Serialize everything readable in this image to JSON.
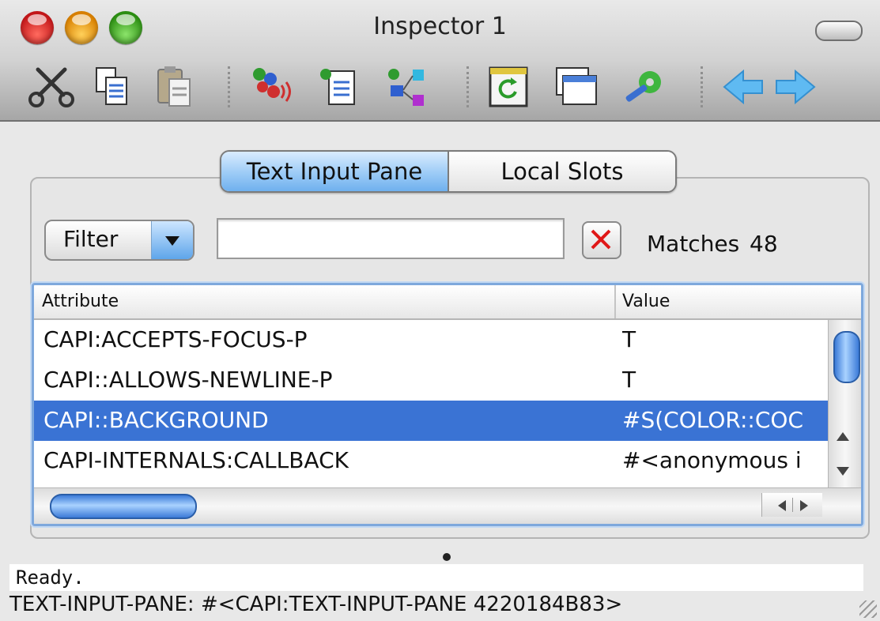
{
  "window": {
    "title": "Inspector 1"
  },
  "toolbar": {
    "buttons": [
      {
        "name": "cut",
        "icon": "scissors-icon"
      },
      {
        "name": "copy",
        "icon": "copy-icon"
      },
      {
        "name": "paste",
        "icon": "paste-icon"
      },
      {
        "name": "inspect-object",
        "icon": "object-signal-icon"
      },
      {
        "name": "browse",
        "icon": "document-list-icon"
      },
      {
        "name": "class-browser",
        "icon": "class-tree-icon"
      },
      {
        "name": "refresh",
        "icon": "refresh-icon"
      },
      {
        "name": "new-window",
        "icon": "window-icon"
      },
      {
        "name": "preferences",
        "icon": "wrench-gear-icon"
      },
      {
        "name": "back",
        "icon": "arrow-left-icon"
      },
      {
        "name": "forward",
        "icon": "arrow-right-icon"
      }
    ]
  },
  "tabs": [
    {
      "label": "Text Input Pane",
      "active": true
    },
    {
      "label": "Local Slots",
      "active": false
    }
  ],
  "filter": {
    "mode_label": "Filter",
    "query": "",
    "matches_label": "Matches",
    "matches_count": "48"
  },
  "table": {
    "columns": [
      "Attribute",
      "Value"
    ],
    "rows": [
      {
        "attribute": "CAPI:ACCEPTS-FOCUS-P",
        "value": "T",
        "selected": false
      },
      {
        "attribute": "CAPI::ALLOWS-NEWLINE-P",
        "value": "T",
        "selected": false
      },
      {
        "attribute": "CAPI::BACKGROUND",
        "value": "#S(COLOR::COC",
        "selected": true
      },
      {
        "attribute": "CAPI-INTERNALS:CALLBACK",
        "value": "#<anonymous i",
        "selected": false
      }
    ]
  },
  "status": {
    "message": "Ready.",
    "info": "TEXT-INPUT-PANE: #<CAPI:TEXT-INPUT-PANE  4220184B83>"
  },
  "colors": {
    "selection": "#3a73d4",
    "accent": "#7ea8dc"
  }
}
